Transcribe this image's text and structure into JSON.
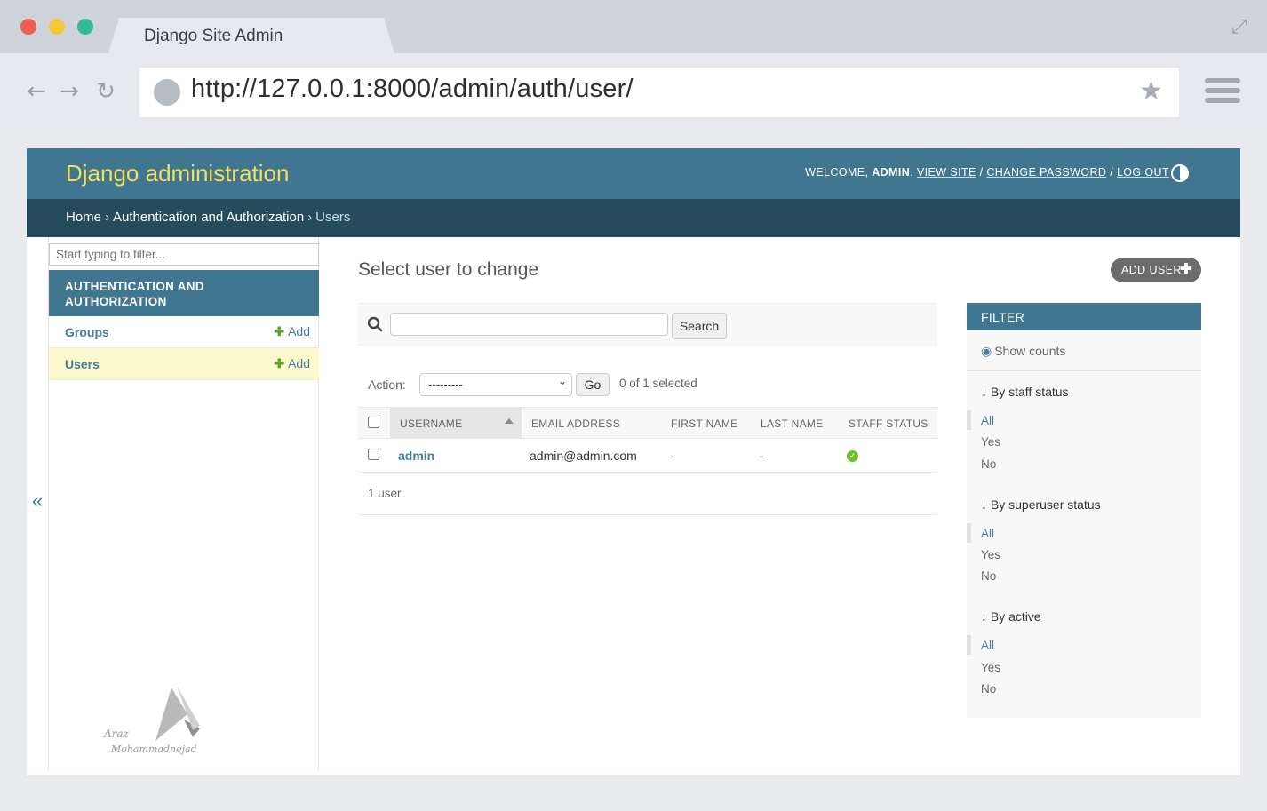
{
  "browser": {
    "tab_title": "Django Site Admin",
    "url": "http://127.0.0.1:8000/admin/auth/user/"
  },
  "header": {
    "brand": "Django administration",
    "welcome": "WELCOME,",
    "username": "ADMIN",
    "view_site": "VIEW SITE",
    "change_password": "CHANGE PASSWORD",
    "log_out": "LOG OUT",
    "separator": "/"
  },
  "breadcrumbs": {
    "home": "Home",
    "app": "Authentication and Authorization",
    "current": "Users",
    "sep": "›"
  },
  "sidebar": {
    "filter_placeholder": "Start typing to filter...",
    "app_caption": "AUTHENTICATION AND AUTHORIZATION",
    "models": [
      {
        "name": "Groups",
        "add": "Add"
      },
      {
        "name": "Users",
        "add": "Add"
      }
    ],
    "collapse": "«"
  },
  "content": {
    "title": "Select user to change",
    "add_user": "ADD USER",
    "search_button": "Search",
    "action_label": "Action:",
    "action_selected": "---------",
    "go_button": "Go",
    "action_counter": "0 of 1 selected",
    "columns": [
      "USERNAME",
      "EMAIL ADDRESS",
      "FIRST NAME",
      "LAST NAME",
      "STAFF STATUS"
    ],
    "rows": [
      {
        "username": "admin",
        "email": "admin@admin.com",
        "first_name": "-",
        "last_name": "-",
        "staff_status": true
      }
    ],
    "paginator": "1 user"
  },
  "filter": {
    "title": "FILTER",
    "show_counts": "Show counts",
    "groups": [
      {
        "title": "↓ By staff status",
        "options": [
          "All",
          "Yes",
          "No"
        ]
      },
      {
        "title": "↓ By superuser status",
        "options": [
          "All",
          "Yes",
          "No"
        ]
      },
      {
        "title": "↓ By active",
        "options": [
          "All",
          "Yes",
          "No"
        ]
      }
    ]
  },
  "colors": {
    "header": "#417690",
    "breadcrumbs": "#264b5d",
    "brand": "#f5dd5d",
    "link": "#447e9b",
    "selected_row": "#fbf9cd",
    "add_green": "#5aa02c"
  },
  "watermark": "Araz Mohammadnejad"
}
